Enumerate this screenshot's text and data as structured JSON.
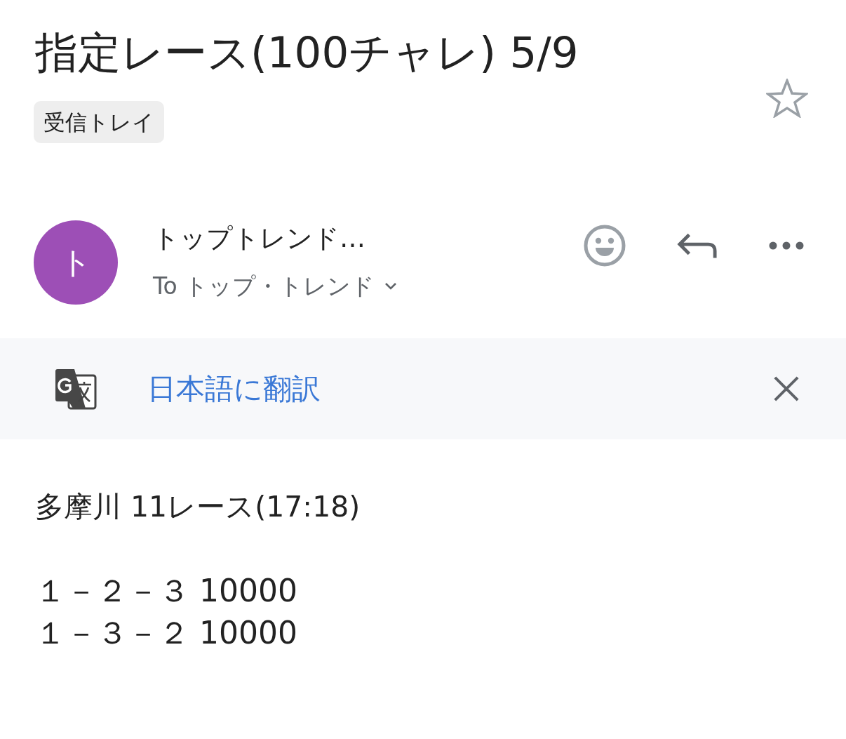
{
  "subject": {
    "title": "指定レース(100チャレ) 5/9",
    "label": "受信トレイ",
    "starred": false
  },
  "sender": {
    "avatar_letter": "ト",
    "name": "トップトレンド…",
    "recipient": "To トップ・トレンド"
  },
  "translate_bar": {
    "link": "日本語に翻訳"
  },
  "body": {
    "paragraphs": [
      {
        "lines": [
          "多摩川 11レース(17:18)"
        ]
      },
      {
        "lines": [
          "１－２－３ 10000",
          "１－３－２ 10000"
        ]
      }
    ]
  }
}
